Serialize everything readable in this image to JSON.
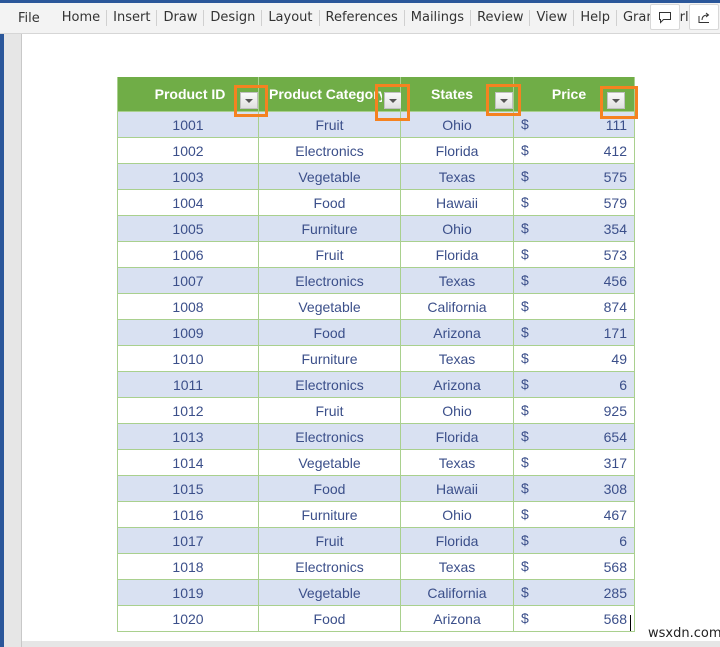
{
  "ribbon": {
    "file": "File",
    "tabs": [
      "Home",
      "Insert",
      "Draw",
      "Design",
      "Layout",
      "References",
      "Mailings",
      "Review",
      "View",
      "Help",
      "Grammarly"
    ],
    "comments_icon": "comment-icon",
    "share_icon": "share-icon"
  },
  "table": {
    "headers": [
      "Product ID",
      "Product Category",
      "States",
      "Price"
    ],
    "currency_symbol": "$",
    "header_color": "#70ad47",
    "band_color": "#d9e1f2",
    "highlight_color": "#f58220",
    "rows": [
      {
        "id": "1001",
        "category": "Fruit",
        "state": "Ohio",
        "price": "111"
      },
      {
        "id": "1002",
        "category": "Electronics",
        "state": "Florida",
        "price": "412"
      },
      {
        "id": "1003",
        "category": "Vegetable",
        "state": "Texas",
        "price": "575"
      },
      {
        "id": "1004",
        "category": "Food",
        "state": "Hawaii",
        "price": "579"
      },
      {
        "id": "1005",
        "category": "Furniture",
        "state": "Ohio",
        "price": "354"
      },
      {
        "id": "1006",
        "category": "Fruit",
        "state": "Florida",
        "price": "573"
      },
      {
        "id": "1007",
        "category": "Electronics",
        "state": "Texas",
        "price": "456"
      },
      {
        "id": "1008",
        "category": "Vegetable",
        "state": "California",
        "price": "874"
      },
      {
        "id": "1009",
        "category": "Food",
        "state": "Arizona",
        "price": "171"
      },
      {
        "id": "1010",
        "category": "Furniture",
        "state": "Texas",
        "price": "49"
      },
      {
        "id": "1011",
        "category": "Electronics",
        "state": "Arizona",
        "price": "6"
      },
      {
        "id": "1012",
        "category": "Fruit",
        "state": "Ohio",
        "price": "925"
      },
      {
        "id": "1013",
        "category": "Electronics",
        "state": "Florida",
        "price": "654"
      },
      {
        "id": "1014",
        "category": "Vegetable",
        "state": "Texas",
        "price": "317"
      },
      {
        "id": "1015",
        "category": "Food",
        "state": "Hawaii",
        "price": "308"
      },
      {
        "id": "1016",
        "category": "Furniture",
        "state": "Ohio",
        "price": "467"
      },
      {
        "id": "1017",
        "category": "Fruit",
        "state": "Florida",
        "price": "6"
      },
      {
        "id": "1018",
        "category": "Electronics",
        "state": "Texas",
        "price": "568"
      },
      {
        "id": "1019",
        "category": "Vegetable",
        "state": "California",
        "price": "285"
      },
      {
        "id": "1020",
        "category": "Food",
        "state": "Arizona",
        "price": "568"
      }
    ]
  },
  "watermark": "wsxdn.com"
}
